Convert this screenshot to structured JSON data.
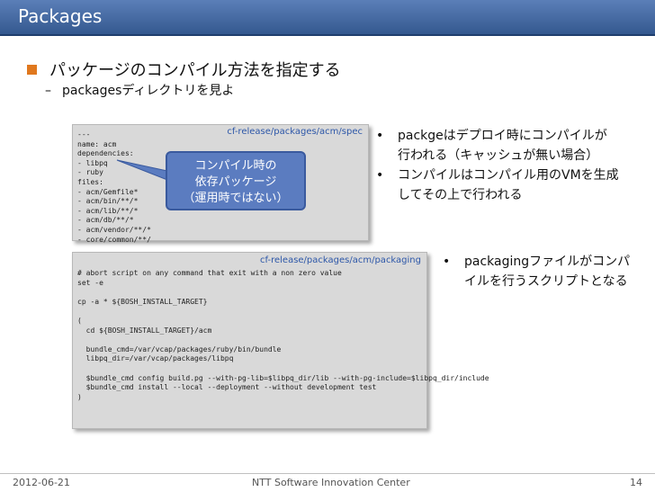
{
  "slide": {
    "title": "Packages",
    "heading": "パッケージのコンパイル方法を指定する",
    "sub_dash": "–",
    "sub": "packagesディレクトリを見よ"
  },
  "spec_box": {
    "path": "cf-release/packages/acm/spec",
    "code": "---\nname: acm\ndependencies:\n- libpq\n- ruby\nfiles:\n- acm/Gemfile*\n- acm/bin/**/*\n- acm/lib/**/*\n- acm/db/**/*\n- acm/vendor/**/*\n- core/common/**/",
    "callout": [
      "コンパイル時の",
      "依存パッケージ",
      "（運用時ではない）"
    ]
  },
  "packaging_box": {
    "path": "cf-release/packages/acm/packaging",
    "code": "# abort script on any command that exit with a non zero value\nset -e\n\ncp -a * ${BOSH_INSTALL_TARGET}\n\n(\n  cd ${BOSH_INSTALL_TARGET}/acm\n\n  bundle_cmd=/var/vcap/packages/ruby/bin/bundle\n  libpq_dir=/var/vcap/packages/libpq\n\n  $bundle_cmd config build.pg --with-pg-lib=$libpq_dir/lib --with-pg-include=$libpq_dir/include\n  $bundle_cmd install --local --deployment --without development test\n)"
  },
  "bullets_right": [
    {
      "marker": "•",
      "text": "packgeはデプロイ時にコンパイルが行われる（キャッシュが無い場合）"
    },
    {
      "marker": "•",
      "text": "コンパイルはコンパイル用のVMを生成してその上で行われる"
    }
  ],
  "bullets_right2": [
    {
      "marker": "•",
      "text": "packagingファイルがコンパイルを行うスクリプトとなる"
    }
  ],
  "footer": {
    "date": "2012-06-21",
    "org": "NTT Software Innovation Center",
    "page": "14"
  }
}
